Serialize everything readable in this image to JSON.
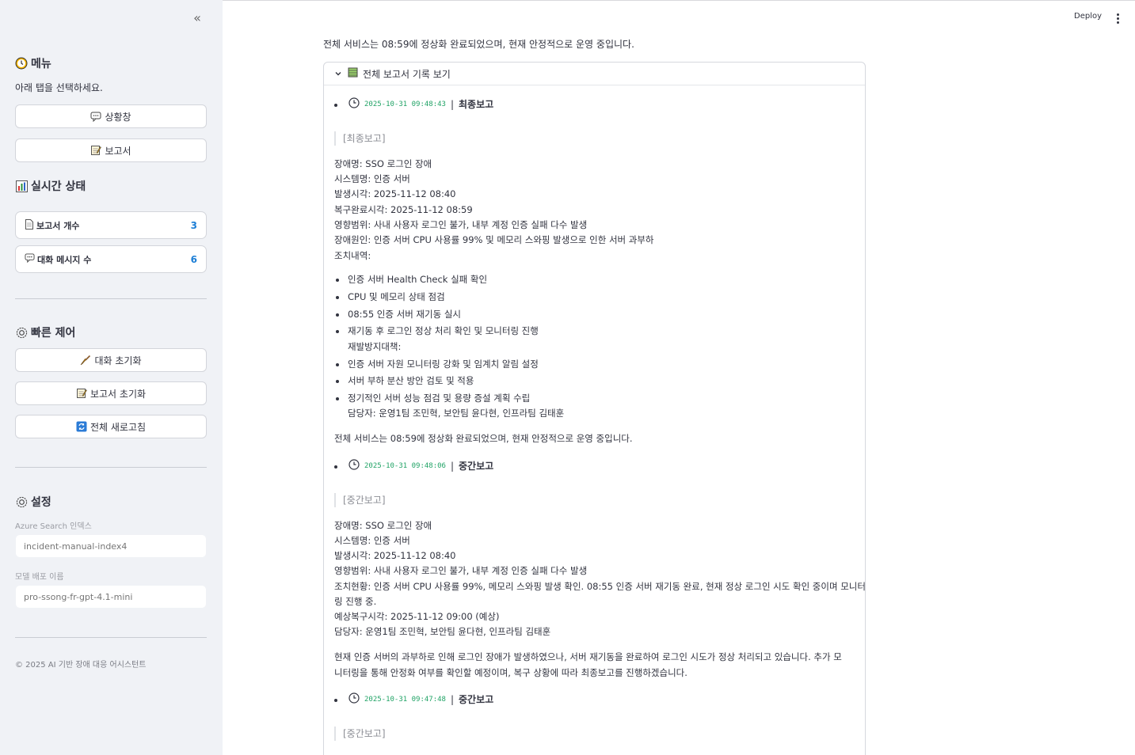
{
  "sidebar": {
    "menu_title": "메뉴",
    "menu_caption": "아래 탭을 선택하세요.",
    "btn_chat": "상황창",
    "btn_report": "보고서",
    "status_title": "실시간 상태",
    "metric_reports_label": "보고서 개수",
    "metric_reports_value": "3",
    "metric_messages_label": "대화 메시지 수",
    "metric_messages_value": "6",
    "quick_title": "빠른 제어",
    "btn_reset_chat": "대화 초기화",
    "btn_reset_report": "보고서 초기화",
    "btn_refresh": "전체 새로고침",
    "settings_title": "설정",
    "field_index_label": "Azure Search 인덱스",
    "field_index_placeholder": "incident-manual-index4",
    "field_model_label": "모델 배포 이름",
    "field_model_placeholder": "pro-ssong-fr-gpt-4.1-mini",
    "footer": "© 2025 AI 기반 장애 대응 어시스턴트"
  },
  "header": {
    "deploy": "Deploy"
  },
  "main": {
    "top_text": "전체 서비스는 08:59에 정상화 완료되었으며, 현재 안정적으로 운영 중입니다.",
    "expander_label": "전체 보고서 기록 보기",
    "entries": [
      {
        "timestamp": "2025-10-31 09:48:43",
        "sep": "|",
        "title": "최종보고",
        "quote": "[최종보고]",
        "lines": [
          "장애명: SSO 로그인 장애",
          "시스템명: 인증 서버",
          "발생시각: 2025-11-12 08:40",
          "복구완료시각: 2025-11-12 08:59",
          "영향범위: 사내 사용자 로그인 불가, 내부 계정 인증 실패 다수 발생",
          "장애원인: 인증 서버 CPU 사용률 99% 및 메모리 스와핑 발생으로 인한 서버 과부하",
          "조치내역:"
        ],
        "bullets": [
          "인증 서버 Health Check 실패 확인",
          "CPU 및 메모리 상태 점검",
          "08:55 인증 서버 재기동 실시",
          "재기동 후 로그인 정상 처리 확인 및 모니터링 진행",
          "재발방지대책:",
          "인증 서버 자원 모니터링 강화 및 임계치 알림 설정",
          "서버 부하 분산 방안 검토 및 적용",
          "정기적인 서버 성능 점검 및 용량 증설 계획 수립",
          "담당자: 운영1팀 조민혁, 보안팀 윤다현, 인프라팀 김태훈"
        ],
        "summary": "전체 서비스는 08:59에 정상화 완료되었으며, 현재 안정적으로 운영 중입니다."
      },
      {
        "timestamp": "2025-10-31 09:48:06",
        "sep": "|",
        "title": "중간보고",
        "quote": "[중간보고]",
        "lines": [
          "장애명: SSO 로그인 장애",
          "시스템명: 인증 서버",
          "발생시각: 2025-11-12 08:40",
          "영향범위: 사내 사용자 로그인 불가, 내부 계정 인증 실패 다수 발생",
          "조치현황: 인증 서버 CPU 사용률 99%, 메모리 스와핑 발생 확인. 08:55 인증 서버 재기동 완료, 현재 정상 로그인 시도 확인 중이며 모니터",
          "링 진행 중.",
          "예상복구시각: 2025-11-12 09:00 (예상)",
          "담당자: 운영1팀 조민혁, 보안팀 윤다현, 인프라팀 김태훈"
        ],
        "summary_1": "현재 인증 서버의 과부하로 인해 로그인 장애가 발생하였으나, 서버 재기동을 완료하여 로그인 시도가 정상 처리되고 있습니다. 추가 모",
        "summary_2": "니터링을 통해 안정화 여부를 확인할 예정이며, 복구 상황에 따라 최종보고를 진행하겠습니다."
      },
      {
        "timestamp": "2025-10-31 09:47:48",
        "sep": "|",
        "title": "중간보고",
        "quote": "[중간보고]"
      }
    ]
  },
  "colors": {
    "sidebar_bg": "#f0f2f6",
    "accent_value": "#1c7ed6",
    "timestamp": "#21a366"
  }
}
